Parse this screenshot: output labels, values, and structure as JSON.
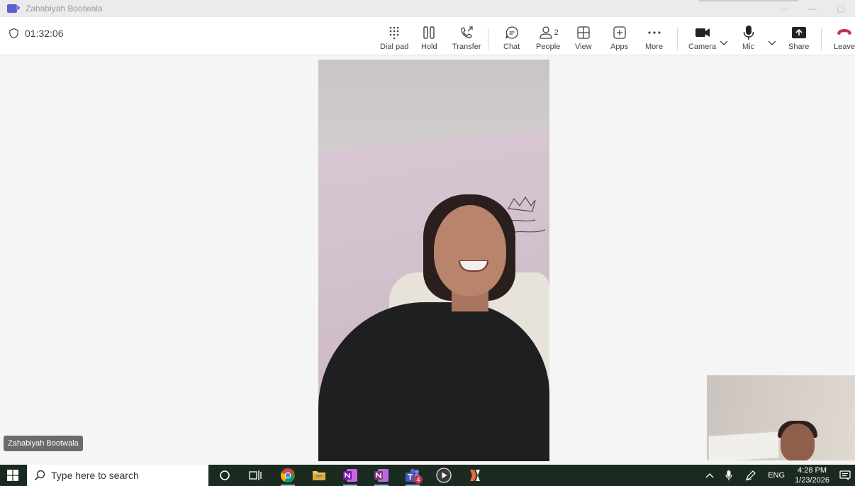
{
  "window": {
    "title": "Zahabiyah Bootwala",
    "more_label": "···",
    "minimize_label": "—",
    "maximize_label": "▢"
  },
  "call": {
    "timer": "01:32:06"
  },
  "toolbar": {
    "dial_pad": "Dial pad",
    "hold": "Hold",
    "transfer": "Transfer",
    "chat": "Chat",
    "people": "People",
    "people_count": "2",
    "view": "View",
    "apps": "Apps",
    "more": "More",
    "camera": "Camera",
    "mic": "Mic",
    "share": "Share",
    "leave": "Leave"
  },
  "stage": {
    "participant_name": "Zahabiyah Bootwala"
  },
  "taskbar": {
    "search_placeholder": "Type here to search",
    "teams_badge": "4",
    "language": "ENG",
    "time": "4:28 PM",
    "date": "1/23/2026",
    "icons": [
      "windows-start-icon",
      "search-icon",
      "cortana-icon",
      "task-view-icon",
      "chrome-icon",
      "file-explorer-icon",
      "onenote-icon",
      "onenote-alt-icon",
      "teams-icon",
      "media-player-icon",
      "app-icon"
    ]
  },
  "colors": {
    "accent": "#5b5fc7",
    "leave_red": "#c4314b",
    "taskbar": "#1b2a20"
  }
}
